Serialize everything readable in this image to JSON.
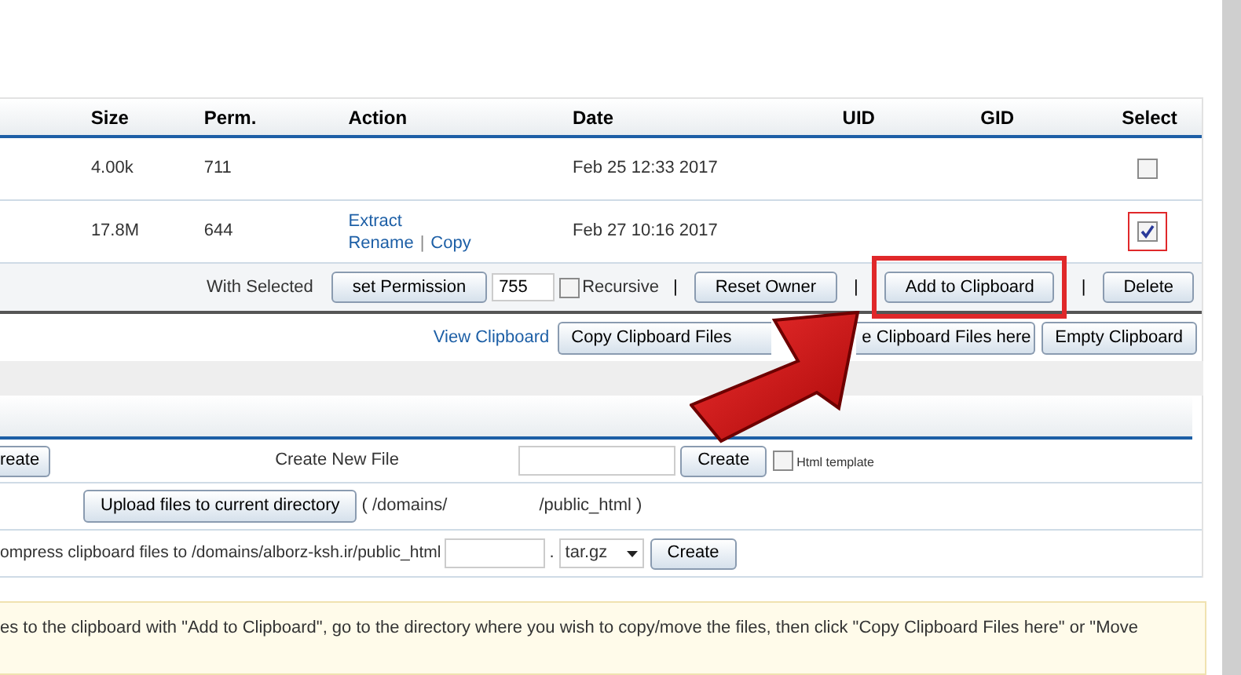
{
  "table": {
    "columns": [
      "Size",
      "Perm.",
      "Action",
      "Date",
      "UID",
      "GID",
      "Select"
    ],
    "rows": [
      {
        "size": "4.00k",
        "perm": "711",
        "action_lines": [],
        "date": "Feb 25 12:33 2017",
        "selected": false,
        "highlighted": false
      },
      {
        "size": "17.8M",
        "perm": "644",
        "action_lines": [
          [
            "Extract"
          ],
          [
            "Rename",
            "Copy"
          ]
        ],
        "date": "Feb 27 10:16 2017",
        "selected": true,
        "highlighted": true
      }
    ],
    "action_separator": "|"
  },
  "with_selected": {
    "label": "With Selected",
    "items": [
      {
        "kind": "button",
        "label": "set Permission",
        "highlighted": false
      },
      {
        "kind": "input",
        "value": "755"
      },
      {
        "kind": "checkbox",
        "label": "Recursive",
        "checked": false
      },
      {
        "kind": "separator",
        "text": "|"
      },
      {
        "kind": "button",
        "label": "Reset Owner",
        "highlighted": false
      },
      {
        "kind": "separator",
        "text": "|"
      },
      {
        "kind": "button",
        "label": "Add to Clipboard",
        "highlighted": true
      },
      {
        "kind": "separator",
        "text": "|"
      },
      {
        "kind": "button",
        "label": "Delete",
        "highlighted": false
      }
    ]
  },
  "clipboard": {
    "link": "View Clipboard",
    "buttons": [
      "Copy Clipboard Files",
      "e Clipboard Files here",
      "Empty Clipboard"
    ]
  },
  "tools": {
    "create_row": {
      "left_button": "reate",
      "label": "Create New File",
      "button": "Create",
      "checkbox": {
        "label": "Html template",
        "checked": false
      }
    },
    "upload_row": {
      "button": "Upload files to current directory",
      "path_start": "( /domains/",
      "path_end": "/public_html )"
    },
    "compress_row": {
      "label": "ompress clipboard files to /domains/alborz-ksh.ir/public_html",
      "dot": ".",
      "format": "tar.gz",
      "button": "Create"
    }
  },
  "notice": "es to the clipboard with \"Add to Clipboard\", go to the directory where you wish to copy/move the files, then click \"Copy Clipboard Files here\" or \"Move"
}
